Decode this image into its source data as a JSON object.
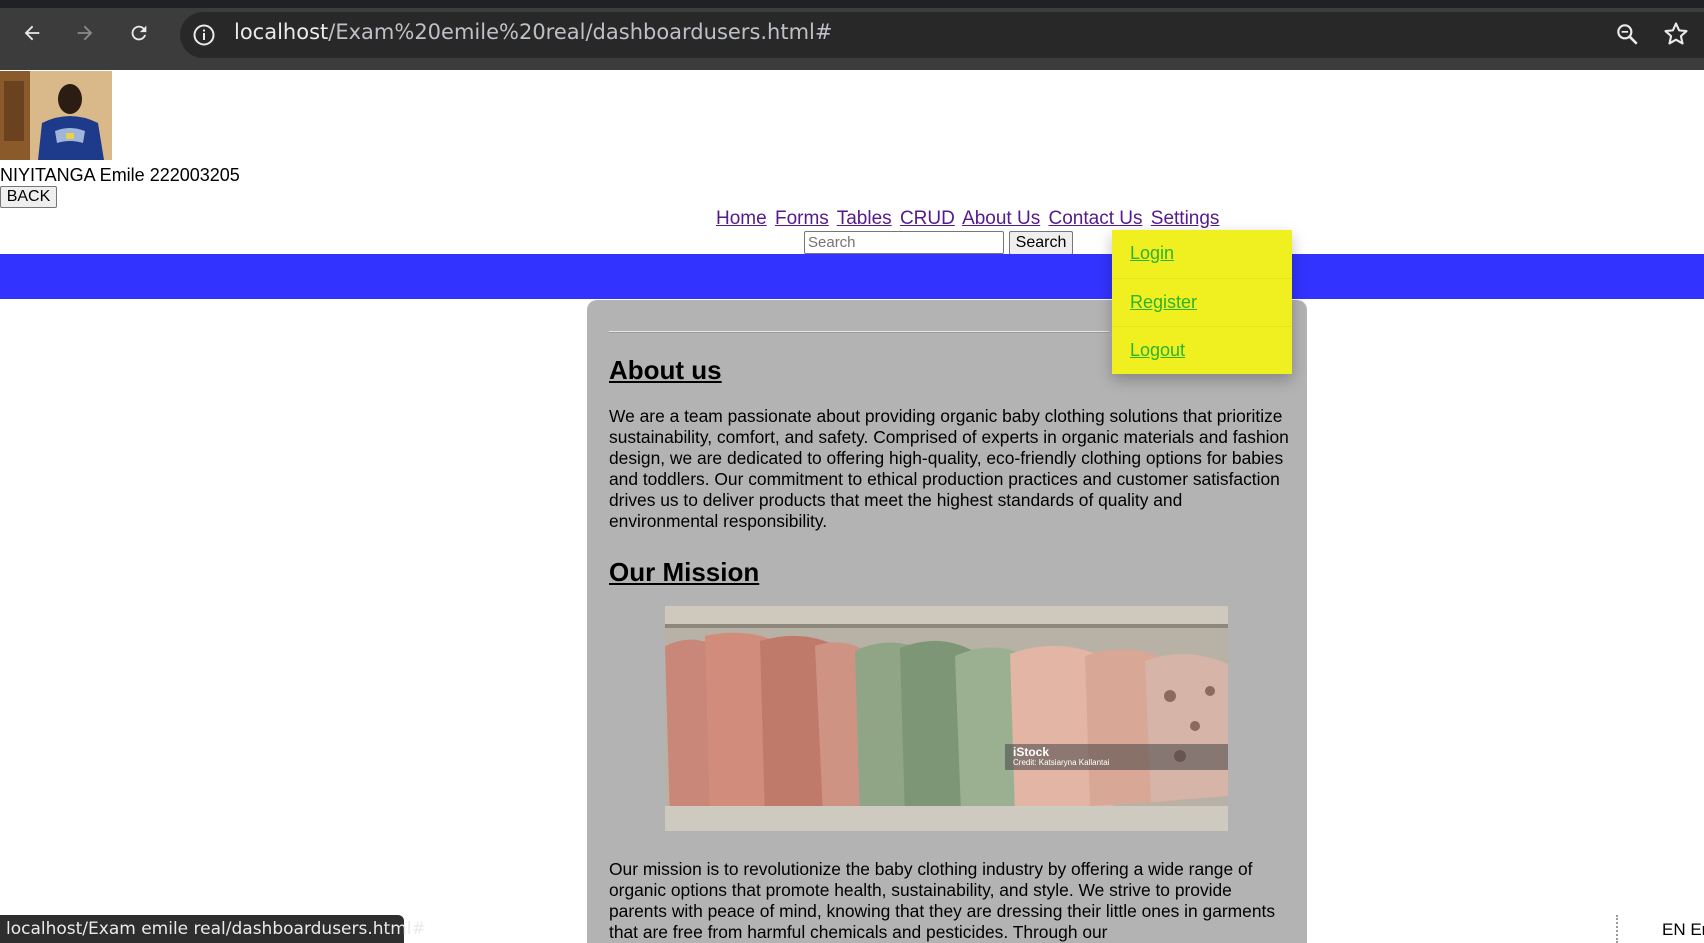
{
  "browser": {
    "url_host": "localhost",
    "url_path": "/Exam%20emile%20real/dashboardusers.html#",
    "status_url": "localhost/Exam emile real/dashboardusers.html#"
  },
  "profile": {
    "name": "NIYITANGA Emile 222003205",
    "back_label": "BACK"
  },
  "nav": {
    "items": [
      {
        "label": "Home"
      },
      {
        "label": "Forms"
      },
      {
        "label": "Tables"
      },
      {
        "label": "CRUD"
      },
      {
        "label": "About Us"
      },
      {
        "label": "Contact Us"
      },
      {
        "label": "Settings"
      }
    ]
  },
  "search": {
    "placeholder": "Search",
    "button_label": "Search"
  },
  "settings_menu": {
    "items": [
      {
        "label": "Login"
      },
      {
        "label": "Register"
      },
      {
        "label": "Logout"
      }
    ]
  },
  "content": {
    "about_heading": "About us",
    "about_text": "We are a team passionate about providing organic baby clothing solutions that prioritize sustainability, comfort, and safety. Comprised of experts in organic materials and fashion design, we are dedicated to offering high-quality, eco-friendly clothing options for babies and toddlers. Our commitment to ethical production practices and customer satisfaction drives us to deliver products that meet the highest standards of quality and environmental responsibility.",
    "mission_heading": "Our Mission",
    "image_watermark": "iStock",
    "image_credit": "Credit: Katsiaryna Kallantai",
    "mission_text": "Our mission is to revolutionize the baby clothing industry by offering a wide range of organic options that promote health, sustainability, and style. We strive to provide parents with peace of mind, knowing that they are dressing their little ones in garments that are free from harmful chemicals and pesticides. Through our"
  },
  "taskbar": {
    "lang": "EN Er"
  },
  "colors": {
    "band": "#3333ff",
    "dropdown_bg": "#f0f020",
    "dropdown_text": "#2db32d",
    "card_bg": "#b3b3b3",
    "link": "#551a8b"
  }
}
